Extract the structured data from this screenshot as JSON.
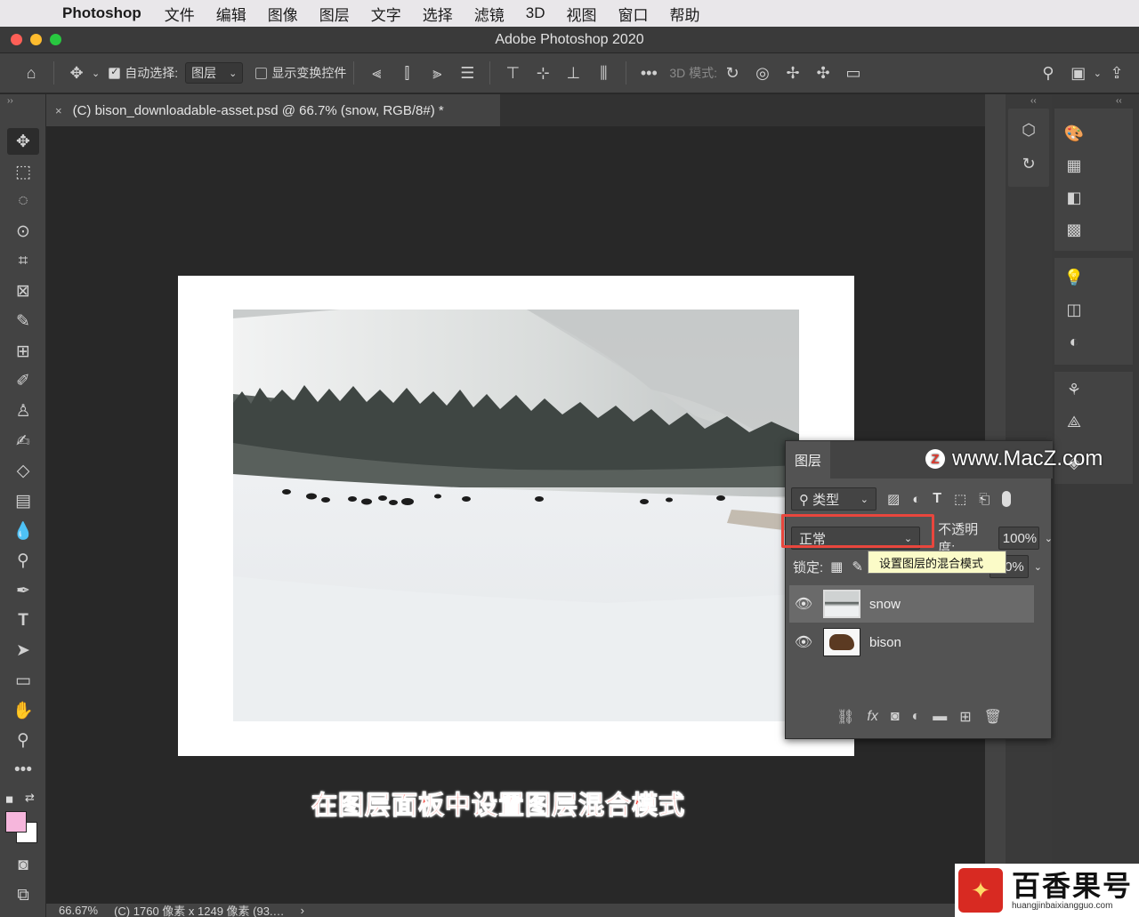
{
  "menubar": {
    "app_name": "Photoshop",
    "items": [
      "文件",
      "编辑",
      "图像",
      "图层",
      "文字",
      "选择",
      "滤镜",
      "3D",
      "视图",
      "窗口",
      "帮助"
    ]
  },
  "window": {
    "title": "Adobe Photoshop 2020"
  },
  "options_bar": {
    "auto_select_label": "自动选择:",
    "auto_select_checked": true,
    "auto_select_target": "图层",
    "show_transform_label": "显示变换控件",
    "show_transform_checked": false,
    "mode_3d_label": "3D 模式:",
    "more_label": "•••"
  },
  "document_tab": {
    "close": "×",
    "title": "(C) bison_downloadable-asset.psd @ 66.7% (snow, RGB/8#) *"
  },
  "caption": "在图层面板中设置图层混合模式",
  "status": {
    "zoom": "66.67%",
    "doc_info": "(C) 1760 像素 x 1249 像素 (93.…",
    "arrow": "›"
  },
  "colors": {
    "foreground": "#f6b6dc",
    "background": "#ffffff",
    "accent_highlight": "#e9463d"
  },
  "layers_panel": {
    "tab_label": "图层",
    "filter_label": "类型",
    "blend_mode": "正常",
    "opacity_label": "不透明度:",
    "opacity_value": "100%",
    "lock_label": "锁定:",
    "fill_value_partial": "0%",
    "tooltip": "设置图层的混合模式",
    "layers": [
      {
        "name": "snow",
        "visible": true,
        "selected": true
      },
      {
        "name": "bison",
        "visible": true,
        "selected": false
      }
    ]
  },
  "watermark": {
    "text": "www.MacZ.com",
    "badge": "Z"
  },
  "brand": {
    "title": "百香果号",
    "url": "huangjinbaixiangguo.com"
  },
  "icons": {
    "tools": [
      "move-icon",
      "marquee-icon",
      "lasso-icon",
      "quick-select-icon",
      "crop-icon",
      "frame-icon",
      "eyedropper-icon",
      "healing-icon",
      "brush-icon",
      "stamp-icon",
      "history-brush-icon",
      "eraser-icon",
      "gradient-icon",
      "blur-icon",
      "dodge-icon",
      "pen-icon",
      "type-icon",
      "path-select-icon",
      "rectangle-icon",
      "hand-icon",
      "zoom-icon",
      "more-icon"
    ]
  }
}
